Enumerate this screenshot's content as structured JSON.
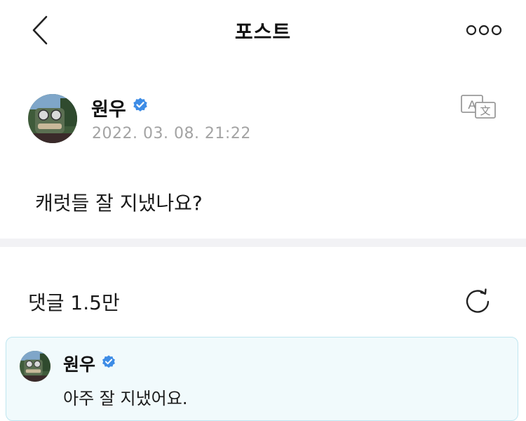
{
  "header": {
    "title": "포스트",
    "back_icon": "chevron-left-icon",
    "more_icon": "more-horizontal-icon"
  },
  "post": {
    "author": "원우",
    "verified_icon": "verified-badge-icon",
    "timestamp": "2022. 03. 08. 21:22",
    "translate_icon": "translate-icon",
    "body": "캐럿들 잘 지냈나요?"
  },
  "comments": {
    "title": "댓글 1.5만",
    "refresh_icon": "refresh-icon",
    "pinned_reply": {
      "author": "원우",
      "text": "아주 잘 지냈어요."
    }
  },
  "colors": {
    "accent_badge": "#3d8ce6",
    "timestamp": "#a3a3a3",
    "divider": "#f2f2f5",
    "reply_card_bg": "#f1fafc",
    "reply_card_border": "#bfe6f0"
  }
}
